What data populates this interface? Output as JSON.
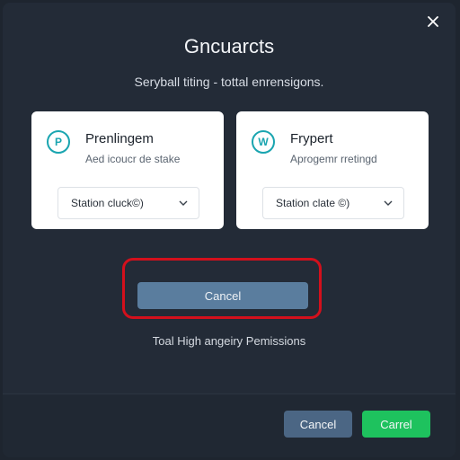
{
  "dialog": {
    "title": "Gncuarcts",
    "subtitle": "Seryball titing - tottal enrensigons.",
    "close_icon": "close-icon"
  },
  "cards": [
    {
      "icon_letter": "P",
      "title": "Prenlingem",
      "description": "Aed icoucr de stake",
      "select_value": "Station cluck©)"
    },
    {
      "icon_letter": "W",
      "title": "Frypert",
      "description": "Aprogemr rretingd",
      "select_value": "Station clate ©)"
    }
  ],
  "main": {
    "cancel_label": "Cancel",
    "permission_note": "Toal High angeiry Pemissions",
    "highlight_color": "#d3101c"
  },
  "footer": {
    "cancel_label": "Cancel",
    "confirm_label": "Carrel"
  },
  "colors": {
    "accent": "#1aa5b0",
    "confirm": "#1ec25e",
    "secondary": "#4b6684"
  }
}
